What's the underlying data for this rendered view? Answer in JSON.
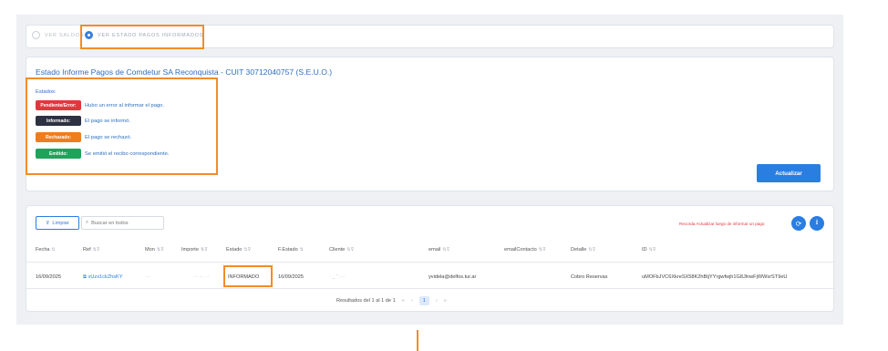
{
  "radio": {
    "opt1": "VER SALDOS",
    "opt2": "VER ESTADO PAGOS INFORMADOS"
  },
  "info": {
    "title": "Estado Informe Pagos de Comdetur SA Reconquista - CUIT 30712040757 (S.E.U.O.)",
    "estados_label": "Estados:",
    "states": [
      {
        "badge": "Pendiente/Error:",
        "desc": "Hubo un error al informar el pago.",
        "color": "#e0383e"
      },
      {
        "badge": "Informado:",
        "desc": "El pago se informó.",
        "color": "#2d3142"
      },
      {
        "badge": "Rechazado:",
        "desc": "El pago se rechazó.",
        "color": "#f07d1c"
      },
      {
        "badge": "Emitido:",
        "desc": "Se emitió el recibo correspondiente.",
        "color": "#1ea45a"
      }
    ],
    "actualizar": "Actualizar"
  },
  "table": {
    "limpiar": "Limpiar",
    "search_placeholder": "Buscar en todos",
    "recuerda": "Recorda Actualizar luego de informar un pago",
    "headers": [
      "Fecha",
      "Ref",
      "Mon",
      "Importe",
      "Estado",
      "F.Estado",
      "Cliente",
      "email",
      "emailContacto",
      "Detalle",
      "ID"
    ],
    "row": {
      "fecha": "16/09/2025",
      "ref": "vUzx1ckZhsKY",
      "mon": "···",
      "importe": "·· ··· ··",
      "estado": "INFORMADO",
      "festado": "16/09/2025",
      "cliente": "·  _  ˘    ···",
      "email": "yvidela@delfos.tur.ar",
      "emailcontacto": "",
      "detalle": "Cobro Reservas",
      "id": "uMOFbJVC6XkreSX58K2hBtjYYrgwfwjh1G8JlnwFjWWsrST9eU"
    },
    "pager_text": "Resultados del 1 al 1 de 1",
    "pages": [
      "«",
      "‹",
      "1",
      "›",
      "»"
    ]
  },
  "colors": {
    "accent": "#2a7de1",
    "highlight": "#f28c28"
  }
}
